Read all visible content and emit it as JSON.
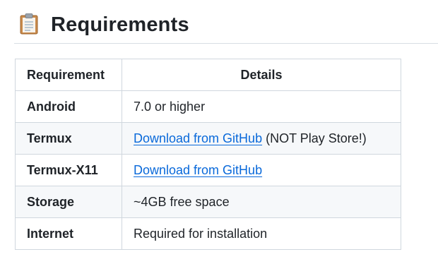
{
  "heading": {
    "icon": "clipboard-icon",
    "title": "Requirements"
  },
  "table": {
    "headers": [
      "Requirement",
      "Details"
    ],
    "rows": [
      {
        "requirement": "Android",
        "details": "7.0 or higher"
      },
      {
        "requirement": "Termux",
        "link": "Download from GitHub",
        "details": "(NOT Play Store!)"
      },
      {
        "requirement": "Termux-X11",
        "link": "Download from GitHub"
      },
      {
        "requirement": "Storage",
        "details": "~4GB free space"
      },
      {
        "requirement": "Internet",
        "details": "Required for installation"
      }
    ]
  },
  "colors": {
    "text": "#1f2328",
    "link": "#0969da",
    "border": "#d0d7de",
    "row_alt": "#f6f8fa"
  }
}
